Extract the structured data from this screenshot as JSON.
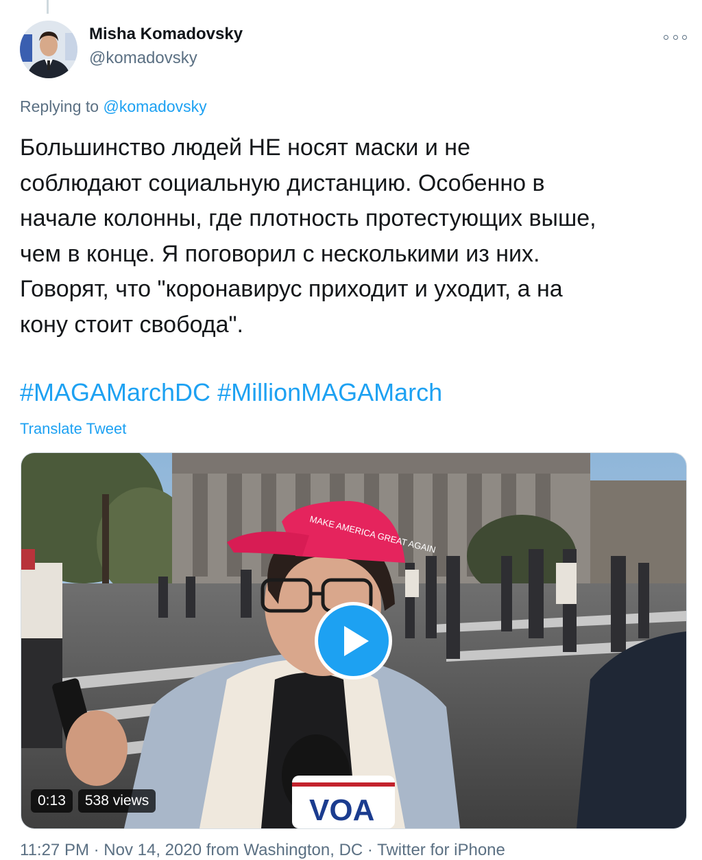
{
  "tweet": {
    "author_name": "Misha Komadovsky",
    "author_handle": "@komadovsky",
    "replying_prefix": "Replying to",
    "replying_to": "@komadovsky",
    "text": "Большинство людей НЕ носят маски и не\nсоблюдают социальную дистанцию. Особенно в\nначале колонны, где плотность протестующих выше,\nчем в конце. Я поговорил с несколькими из них.\nГоворят, что \"коронавирус приходит и уходит, а на\nкону стоит свобода\".",
    "hashtags": [
      "#MAGAMarchDC",
      "#MillionMAGAMarch"
    ],
    "translate_label": "Translate Tweet",
    "meta_partial": "11:27 PM · Nov 14, 2020 from Washington, DC · Twitter for iPhone"
  },
  "video": {
    "duration": "0:13",
    "views": "538 views",
    "cap_text": "MAKE AMERICA GREAT AGAIN",
    "mic_logo": "VOA"
  },
  "colors": {
    "accent": "#1da1f2",
    "secondary_text": "#5b7083",
    "cap": "#e5245d"
  },
  "icons": {
    "more": "more-horizontal-icon",
    "play": "play-icon"
  }
}
